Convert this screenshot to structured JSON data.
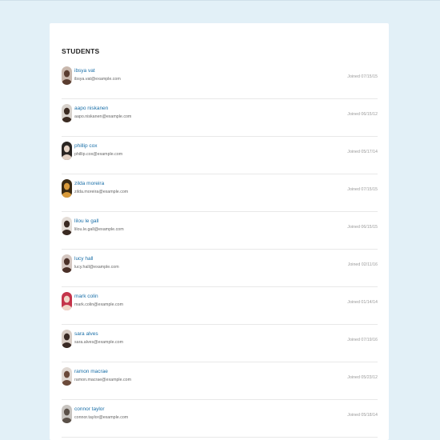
{
  "card": {
    "title": "STUDENTS"
  },
  "students": [
    {
      "name": "ibsya vat",
      "email": "ibsya.vat@example.com",
      "joined": "Joined 07/15/15",
      "avatar_bg": "#c9b8ad",
      "avatar_fg": "#5a3d30"
    },
    {
      "name": "aapo niskanen",
      "email": "aapo.niskanen@example.com",
      "joined": "Joined 06/15/12",
      "avatar_bg": "#d8d2cc",
      "avatar_fg": "#3b2b22"
    },
    {
      "name": "phillip cox",
      "email": "phillip.cox@example.com",
      "joined": "Joined 05/17/14",
      "avatar_bg": "#2a2522",
      "avatar_fg": "#e4d2c4"
    },
    {
      "name": "zilda moreira",
      "email": "zilda.moreira@example.com",
      "joined": "Joined 07/15/15",
      "avatar_bg": "#3a2a14",
      "avatar_fg": "#d99a3a"
    },
    {
      "name": "lilou le gall",
      "email": "lilou.le.gall@example.com",
      "joined": "Joined 06/15/15",
      "avatar_bg": "#e4ddd7",
      "avatar_fg": "#3a2a22"
    },
    {
      "name": "lucy hall",
      "email": "lucy.hall@example.com",
      "joined": "Joined 02/11/16",
      "avatar_bg": "#d4c6c0",
      "avatar_fg": "#4a3028"
    },
    {
      "name": "mark colin",
      "email": "mark.colin@example.com",
      "joined": "Joined 01/14/14",
      "avatar_bg": "#c4344a",
      "avatar_fg": "#f0d6c8"
    },
    {
      "name": "sara alves",
      "email": "sara.alves@example.com",
      "joined": "Joined 07/19/16",
      "avatar_bg": "#d8ccc4",
      "avatar_fg": "#3a2a24"
    },
    {
      "name": "ramon macrae",
      "email": "ramon.macrae@example.com",
      "joined": "Joined 05/23/12",
      "avatar_bg": "#e0d8d2",
      "avatar_fg": "#6b4a3a"
    },
    {
      "name": "connor taylor",
      "email": "connor.taylor@example.com",
      "joined": "Joined 05/18/14",
      "avatar_bg": "#c8c4c0",
      "avatar_fg": "#5a5048"
    }
  ]
}
